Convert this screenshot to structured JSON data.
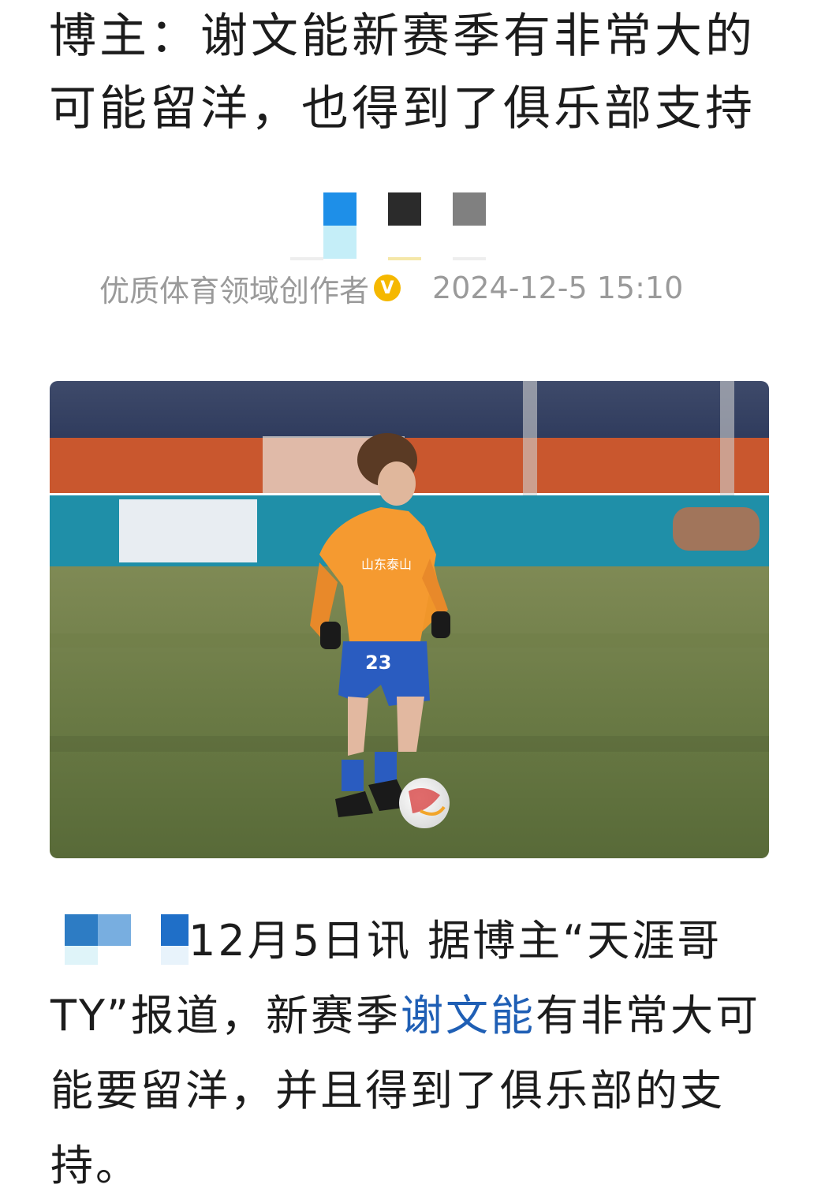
{
  "article": {
    "title": "博主：谢文能新赛季有非常大的可能留洋，也得到了俱乐部支持",
    "author_label": "优质体育领域创作者",
    "verified_badge": "V",
    "datetime": "2024-12-5  15:10"
  },
  "photo": {
    "jersey_number": "23",
    "jersey_sponsor": "山东泰山"
  },
  "body": {
    "intro": "12月5日讯 据博主“天涯哥TY”报道，新赛季",
    "player_link": "谢文能",
    "rest": "有非常大可能要留洋，并且得到了俱乐部的支持。"
  },
  "colors": {
    "link": "#1f5fb5",
    "badge": "#f5b800",
    "meta_text": "#9a9a9a"
  }
}
